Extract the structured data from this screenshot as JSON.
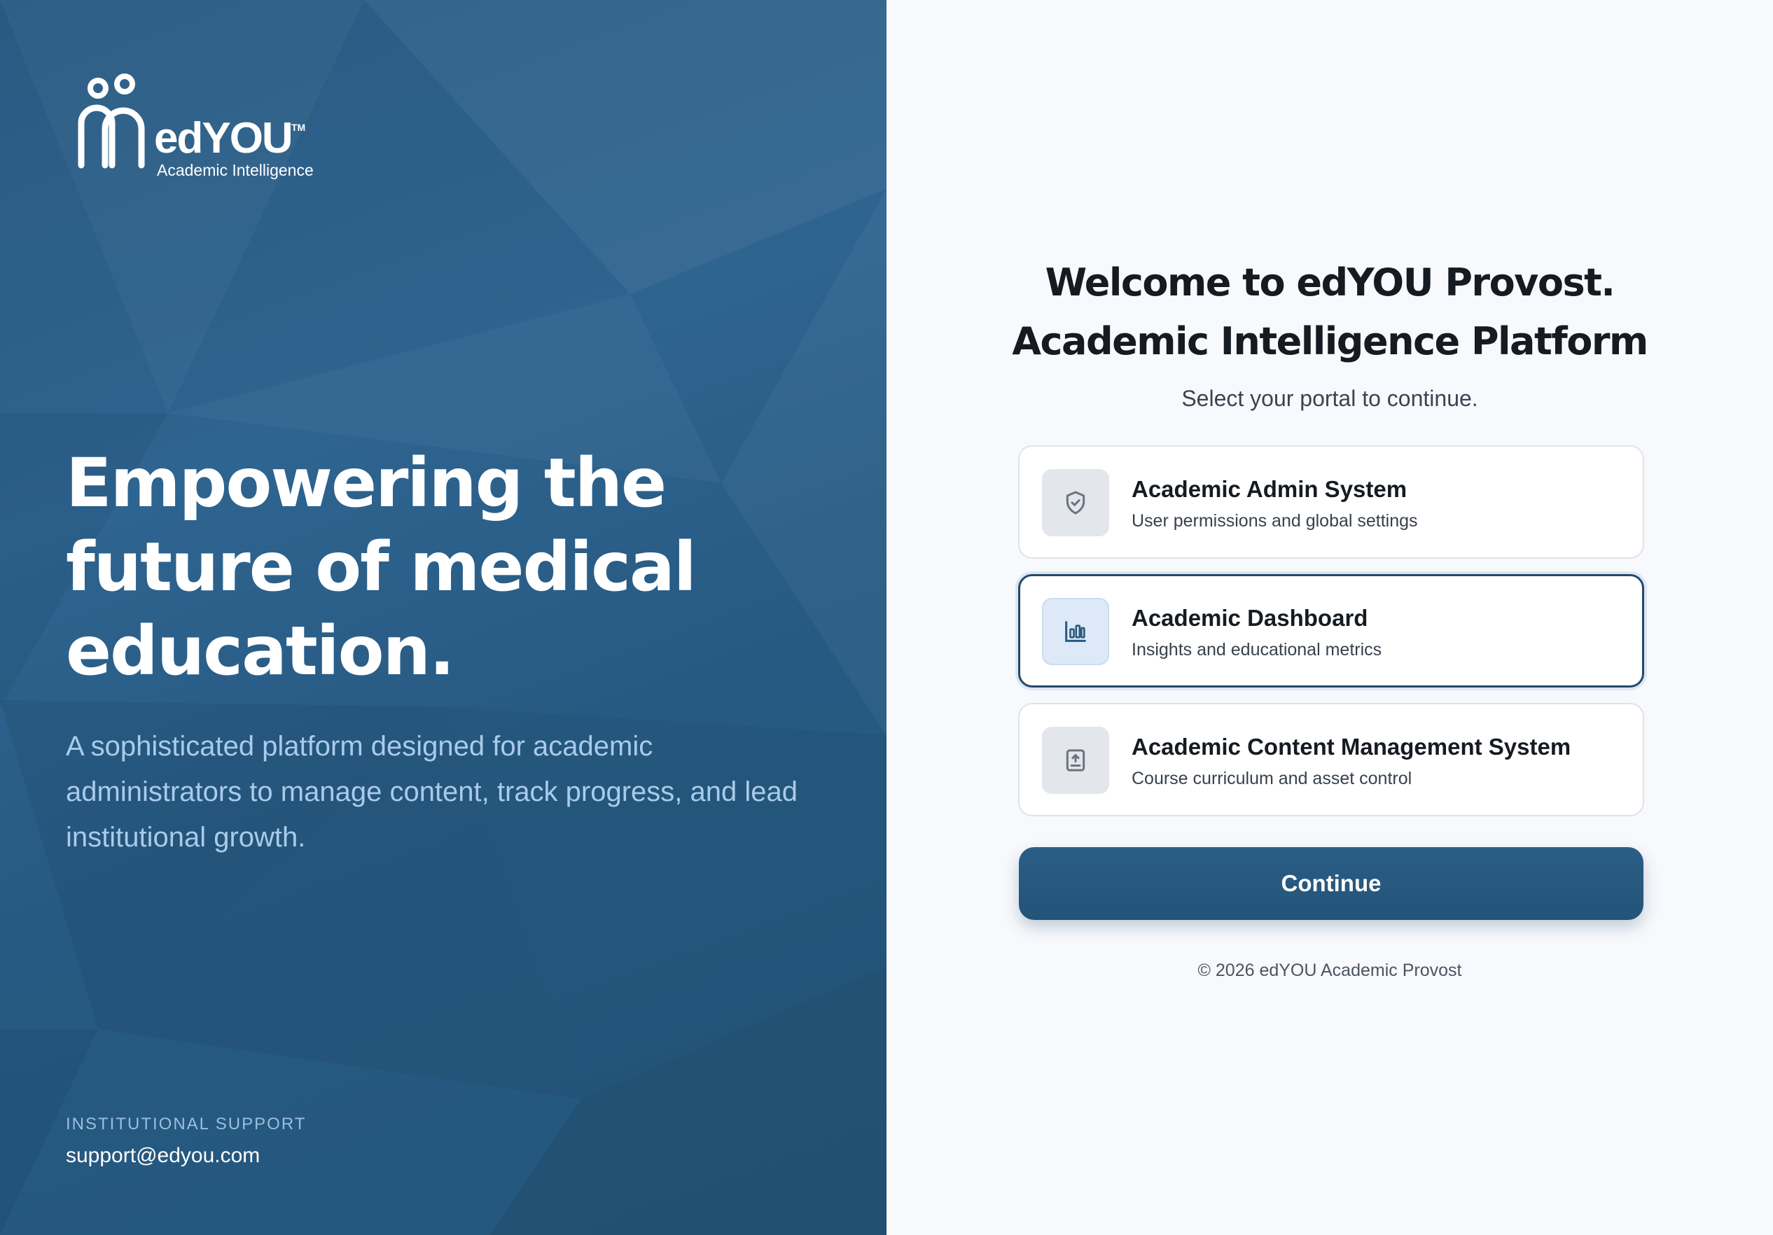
{
  "brand": {
    "name": "edYOU",
    "tm": "TM",
    "subtitle": "Academic Intelligence"
  },
  "hero": {
    "headline": "Empowering the future of medical education.",
    "tagline": "A sophisticated platform designed for academic administrators to manage content, track progress, and lead institutional growth.",
    "support_label": "INSTITUTIONAL SUPPORT",
    "support_email": "support@edyou.com"
  },
  "portal": {
    "title_line1": "Welcome to edYOU Provost.",
    "title_line2": "Academic Intelligence Platform",
    "subtitle": "Select your portal to continue.",
    "options": [
      {
        "title": "Academic Admin System",
        "description": "User permissions and global settings",
        "icon": "shield-check-icon",
        "selected": false
      },
      {
        "title": "Academic Dashboard",
        "description": "Insights and educational metrics",
        "icon": "bar-chart-icon",
        "selected": true
      },
      {
        "title": "Academic Content Management System",
        "description": "Course curriculum and asset control",
        "icon": "upload-document-icon",
        "selected": false
      }
    ],
    "continue_label": "Continue",
    "footer": "© 2026 edYOU Academic Provost"
  },
  "colors": {
    "hero_bg": "#2b5c84",
    "accent": "#245378",
    "selected_border": "#24496b",
    "page_bg": "#f7f9fc"
  }
}
